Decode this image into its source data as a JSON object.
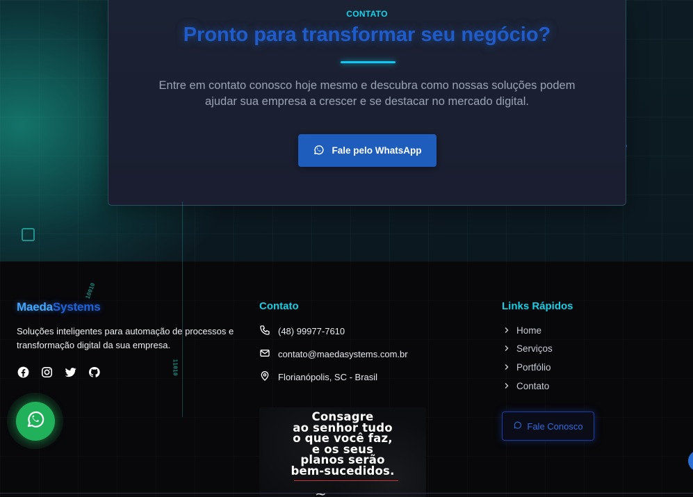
{
  "cta": {
    "eyebrow": "CONTATO",
    "title": "Pronto para transformar seu negócio?",
    "text": "Entre em contato conosco hoje mesmo e descubra como nossas soluções podem ajudar sua empresa a crescer e se destacar no mercado digital.",
    "button_label": "Fale pelo WhatsApp"
  },
  "footer": {
    "brand": {
      "part1": "Maeda",
      "part2": "Systems"
    },
    "description": "Soluções inteligentes para automação de processos e transformação digital da sua empresa.",
    "social": [
      "facebook-icon",
      "instagram-icon",
      "twitter-icon",
      "github-icon"
    ],
    "contact": {
      "title": "Contato",
      "phone": "(48) 99977-7610",
      "email": "contato@maedasystems.com.br",
      "location": "Florianópolis, SC - Brasil"
    },
    "flyer": {
      "lines": [
        "Consagre",
        "ao senhor tudo",
        "o que você faz,",
        "e os seus",
        "planos serão",
        "bem-sucedidos."
      ]
    },
    "links": {
      "title": "Links Rápidos",
      "items": [
        "Home",
        "Serviços",
        "Portfólio",
        "Contato"
      ],
      "button_label": "Fale Conosco"
    }
  },
  "binary": [
    "10010",
    "11010"
  ],
  "colors": {
    "accent": "#17d4ea",
    "primary": "#1e5dbc",
    "whatsapp": "#20b15a"
  }
}
